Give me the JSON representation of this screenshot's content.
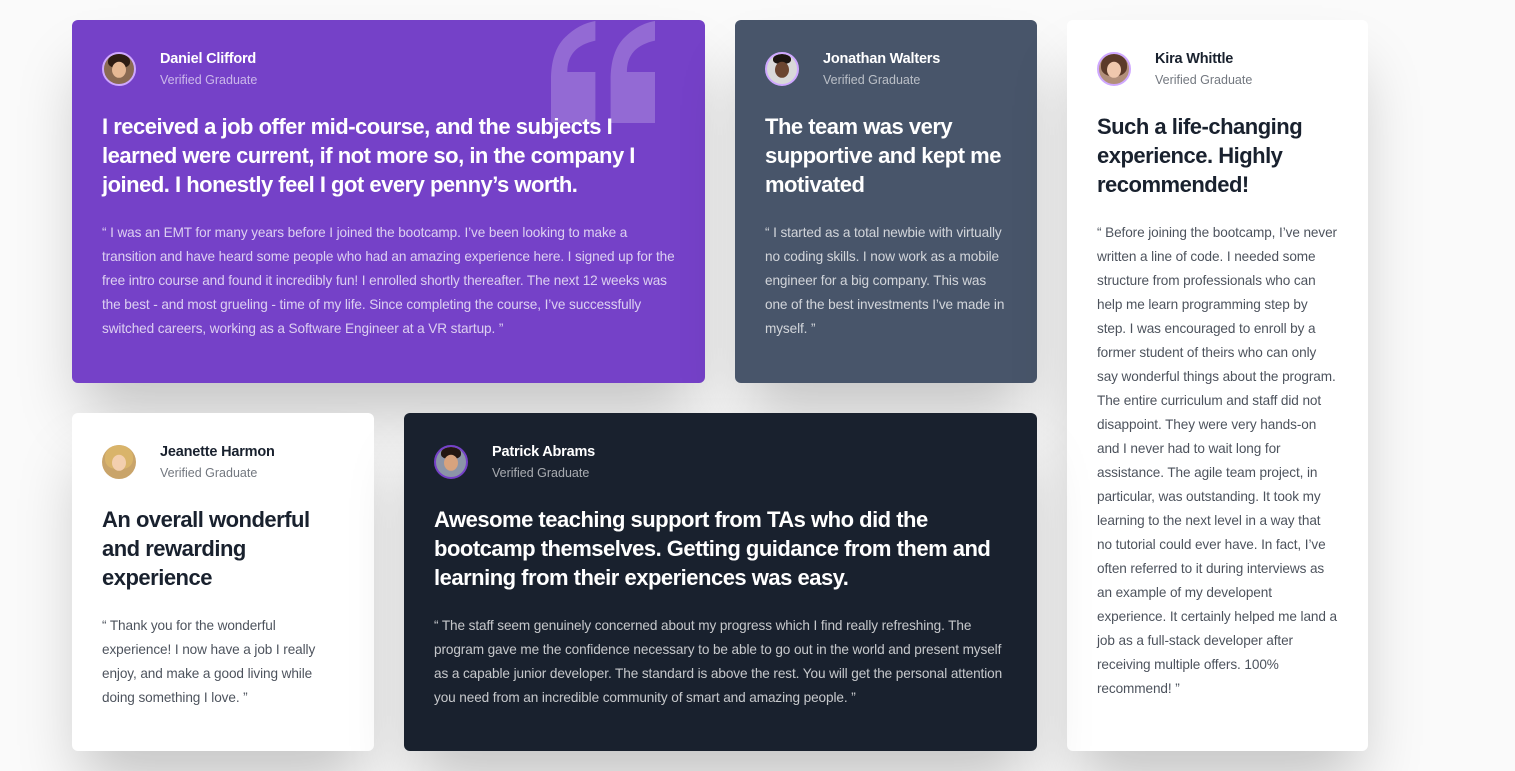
{
  "colors": {
    "moderate_violet": "#7541c8",
    "grayish_blue": "#48556a",
    "very_dark_grayish_blue": "#19212e",
    "white": "#ffffff",
    "light_violet": "#cfa8ff"
  },
  "testimonials": [
    {
      "name": "Daniel Clifford",
      "role": "Verified Graduate",
      "headline": "I received a job offer mid-course, and the subjects I learned were current, if not more so, in the company I joined. I honestly feel I got every penny’s worth.",
      "body": "“ I was an EMT for many years before I joined the bootcamp. I’ve been looking to make a transition and have heard some people who had an amazing experience here. I signed up for the free intro course and found it incredibly fun! I enrolled shortly thereafter. The next 12 weeks was the best - and most grueling - time of my life. Since completing the course, I’ve successfully switched careers, working as a Software Engineer at a VR startup. ”",
      "avatar_icon": "avatar-daniel"
    },
    {
      "name": "Jonathan Walters",
      "role": "Verified Graduate",
      "headline": "The team was very supportive and kept me motivated",
      "body": "“ I started as a total newbie with virtually no coding skills. I now work as a mobile engineer for a big company. This was one of the best investments I’ve made in myself. ”",
      "avatar_icon": "avatar-jonathan"
    },
    {
      "name": "Kira Whittle",
      "role": "Verified Graduate",
      "headline": "Such a life-changing experience. Highly recommended!",
      "body": "“ Before joining the bootcamp, I’ve never written a line of code. I needed some structure from professionals who can help me learn programming step by step. I was encouraged to enroll by a former student of theirs who can only say wonderful things about the program. The entire curriculum and staff did not disappoint. They were very hands-on and I never had to wait long for assistance. The agile team project, in particular, was outstanding. It took my learning to the next level in a way that no tutorial could ever have. In fact, I’ve often referred to it during interviews as an example of my developent experience. It certainly helped me land a job as a full-stack developer after receiving multiple offers. 100% recommend! ”",
      "avatar_icon": "avatar-kira"
    },
    {
      "name": "Jeanette Harmon",
      "role": "Verified Graduate",
      "headline": "An overall wonderful and rewarding experience",
      "body": "“ Thank you for the wonderful experience! I now have a job I really enjoy, and make a good living while doing something I love. ”",
      "avatar_icon": "avatar-jeanette"
    },
    {
      "name": "Patrick Abrams",
      "role": "Verified Graduate",
      "headline": "Awesome teaching support from TAs who did the bootcamp themselves. Getting guidance from them and learning from their experiences was easy.",
      "body": "“ The staff seem genuinely concerned about my progress which I find really refreshing. The program gave me the confidence necessary to be able to go out in the world and present myself as a capable junior developer. The standard is above the rest. You will get the personal attention you need from an incredible community of smart and amazing people. ”",
      "avatar_icon": "avatar-patrick"
    }
  ],
  "decoration": {
    "quote_icon": "quotation-mark-icon"
  }
}
